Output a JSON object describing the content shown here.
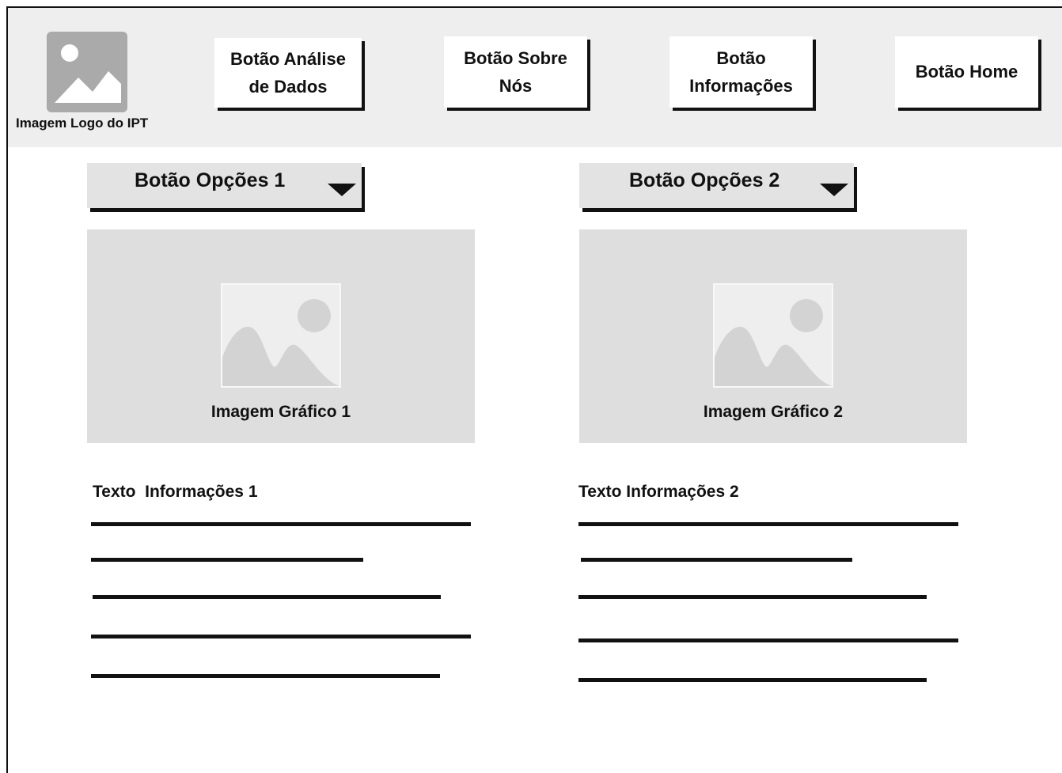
{
  "header": {
    "logo_caption": "Imagem Logo do IPT",
    "nav": [
      {
        "line1": "Botão Análise",
        "line2": "de Dados"
      },
      {
        "line1": "Botão Sobre",
        "line2": "Nós"
      },
      {
        "line1": "Botão",
        "line2": "Informações"
      },
      {
        "line1": "Botão Home",
        "line2": ""
      }
    ]
  },
  "columns": [
    {
      "options_label": "Botão Opções 1",
      "chart_caption": "Imagem Gráfico 1",
      "info_title": "Texto  Informações 1"
    },
    {
      "options_label": "Botão Opções 2",
      "chart_caption": "Imagem Gráfico 2",
      "info_title": "Texto Informações 2"
    }
  ],
  "colors": {
    "header_bg": "#eeeeee",
    "logo_placeholder": "#aaaaaa",
    "chart_bg": "#dedede",
    "options_bg": "#e3e3e3"
  },
  "icons": {
    "logo": "image-placeholder-icon",
    "charts": "image-placeholder-icon",
    "dropdown": "caret-down-icon"
  }
}
